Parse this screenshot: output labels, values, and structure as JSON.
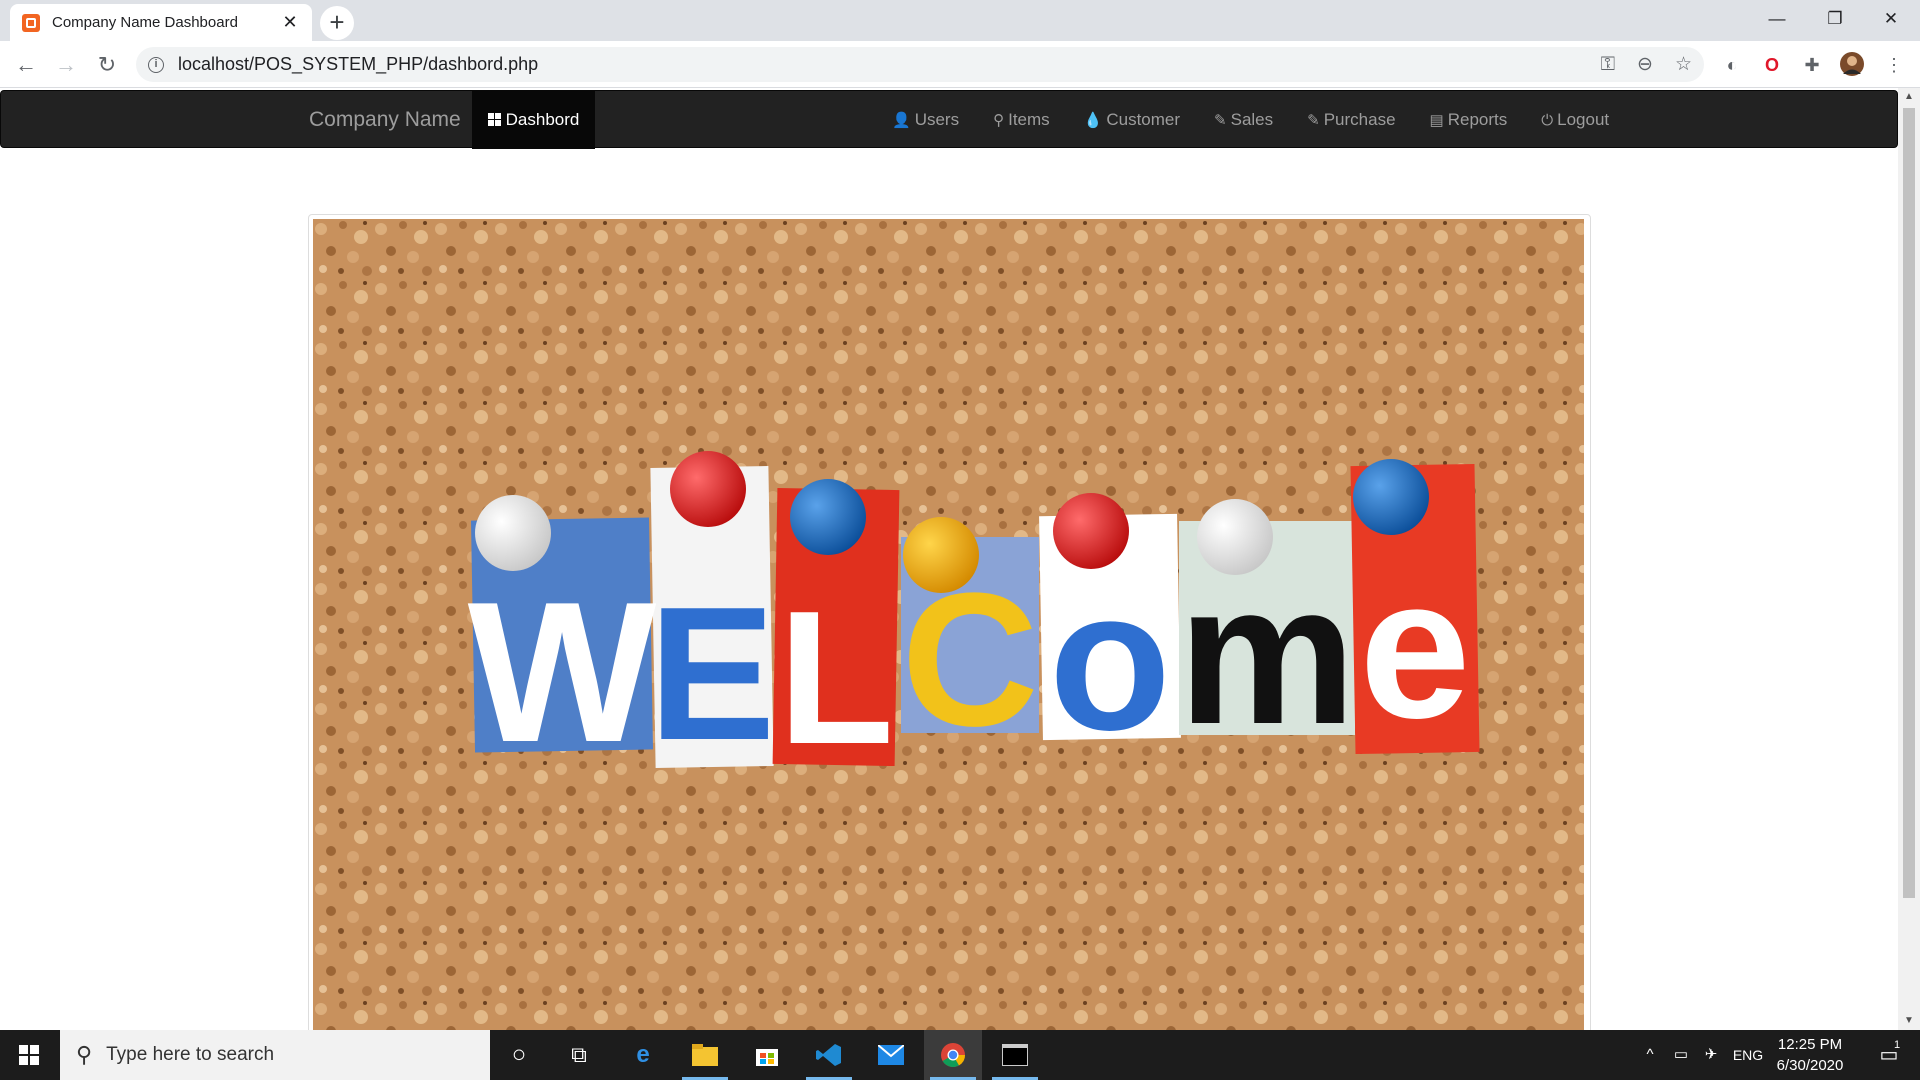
{
  "browser": {
    "tab_title": "Company Name Dashboard",
    "tab_close": "✕",
    "new_tab": "+",
    "url": "localhost/POS_SYSTEM_PHP/dashbord.php"
  },
  "window_controls": {
    "minimize": "—",
    "restore": "❐",
    "close": "✕"
  },
  "navbar": {
    "brand": "Company Name",
    "active_item": "Dashbord",
    "items": [
      {
        "icon": "user-icon",
        "glyph": "👤",
        "label": "Users"
      },
      {
        "icon": "map-marker-icon",
        "glyph": "⚲",
        "label": "Items"
      },
      {
        "icon": "tint-icon",
        "glyph": "💧",
        "label": "Customer"
      },
      {
        "icon": "pencil-icon",
        "glyph": "✎",
        "label": "Sales"
      },
      {
        "icon": "pencil-icon",
        "glyph": "✎",
        "label": "Purchase"
      },
      {
        "icon": "list-alt-icon",
        "glyph": "▤",
        "label": "Reports"
      },
      {
        "icon": "off-icon",
        "glyph": "⏻",
        "label": "Logout"
      }
    ]
  },
  "welcome_image": {
    "letters": [
      "W",
      "E",
      "L",
      "C",
      "o",
      "m",
      "e"
    ]
  },
  "taskbar": {
    "search_placeholder": "Type here to search",
    "language": "ENG",
    "time": "12:25 PM",
    "date": "6/30/2020",
    "notification_count": "1"
  },
  "colors": {
    "navbar_bg": "#222222",
    "navbar_active_bg": "#080808",
    "navbar_text": "#9d9d9d",
    "cork": "#c8915d"
  }
}
